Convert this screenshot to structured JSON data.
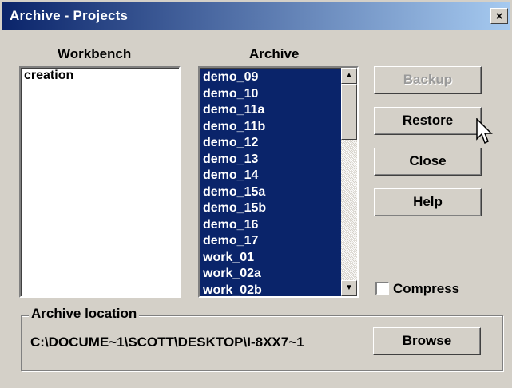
{
  "window": {
    "title": "Archive - Projects",
    "close_label": "×"
  },
  "workbench": {
    "label": "Workbench",
    "items": [
      "creation"
    ]
  },
  "archive": {
    "label": "Archive",
    "items": [
      "demo_09",
      "demo_10",
      "demo_11a",
      "demo_11b",
      "demo_12",
      "demo_13",
      "demo_14",
      "demo_15a",
      "demo_15b",
      "demo_16",
      "demo_17",
      "work_01",
      "work_02a",
      "work_02b"
    ]
  },
  "buttons": {
    "backup": "Backup",
    "restore": "Restore",
    "close": "Close",
    "help": "Help",
    "browse": "Browse"
  },
  "compress": {
    "label": "Compress",
    "checked": false
  },
  "location": {
    "label": "Archive location",
    "path": "C:\\DOCUME~1\\SCOTT\\DESKTOP\\I-8XX7~1"
  },
  "icons": {
    "scroll_up": "arrow-up-icon",
    "scroll_down": "arrow-down-icon",
    "cursor": "mouse-pointer-icon"
  },
  "colors": {
    "title_start": "#0a246a",
    "title_end": "#a6caf0",
    "selection": "#0a246a",
    "face": "#d4d0c8"
  }
}
